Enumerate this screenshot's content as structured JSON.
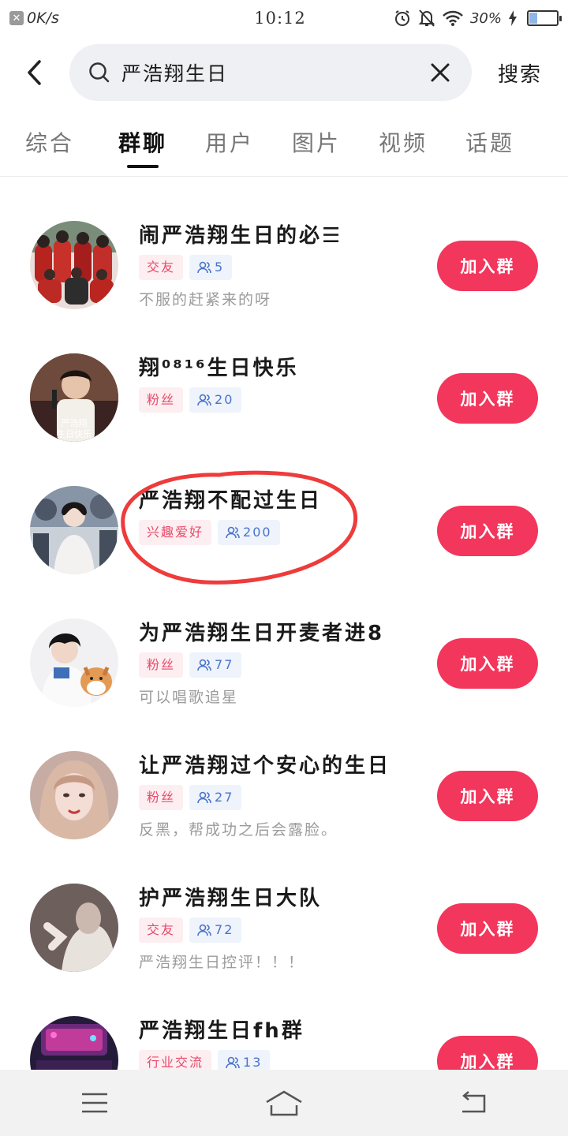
{
  "status_bar": {
    "speed": "0K/s",
    "time": "10:12",
    "battery": "30%",
    "battery_level": 0.3
  },
  "search": {
    "query": "严浩翔生日",
    "submit_label": "搜索"
  },
  "tabs": [
    {
      "label": "综合",
      "active": false
    },
    {
      "label": "群聊",
      "active": true
    },
    {
      "label": "用户",
      "active": false
    },
    {
      "label": "图片",
      "active": false
    },
    {
      "label": "视频",
      "active": false
    },
    {
      "label": "话题",
      "active": false
    }
  ],
  "groups": [
    {
      "title": "闹严浩翔生日的必☰",
      "tag": "交友",
      "members": "5",
      "desc": "不服的赶紧来的呀",
      "join_label": "加入群"
    },
    {
      "title": "翔⁰⁸¹⁶生日快乐",
      "tag": "粉丝",
      "members": "20",
      "desc": "",
      "join_label": "加入群"
    },
    {
      "title": "严浩翔不配过生日",
      "tag": "兴趣爱好",
      "members": "200",
      "desc": "",
      "join_label": "加入群"
    },
    {
      "title": "为严浩翔生日开麦者进8",
      "tag": "粉丝",
      "members": "77",
      "desc": "可以唱歌追星",
      "join_label": "加入群"
    },
    {
      "title": "让严浩翔过个安心的生日",
      "tag": "粉丝",
      "members": "27",
      "desc": "反黑，帮成功之后会露脸。",
      "join_label": "加入群"
    },
    {
      "title": "护严浩翔生日大队",
      "tag": "交友",
      "members": "72",
      "desc": "严浩翔生日控评！！！",
      "join_label": "加入群"
    },
    {
      "title": "严浩翔生日fh群",
      "tag": "行业交流",
      "members": "13",
      "desc": "",
      "join_label": "加入群"
    }
  ],
  "colors": {
    "accent": "#f2365c",
    "tag_type_text": "#e74a6a",
    "tag_count_text": "#4a73c7",
    "highlight": "#ee3b3b"
  },
  "icons": {
    "back": "back-arrow-icon",
    "search": "search-icon",
    "clear": "close-icon",
    "members": "people-icon",
    "menu": "menu-icon",
    "home": "home-icon",
    "return": "return-icon"
  }
}
